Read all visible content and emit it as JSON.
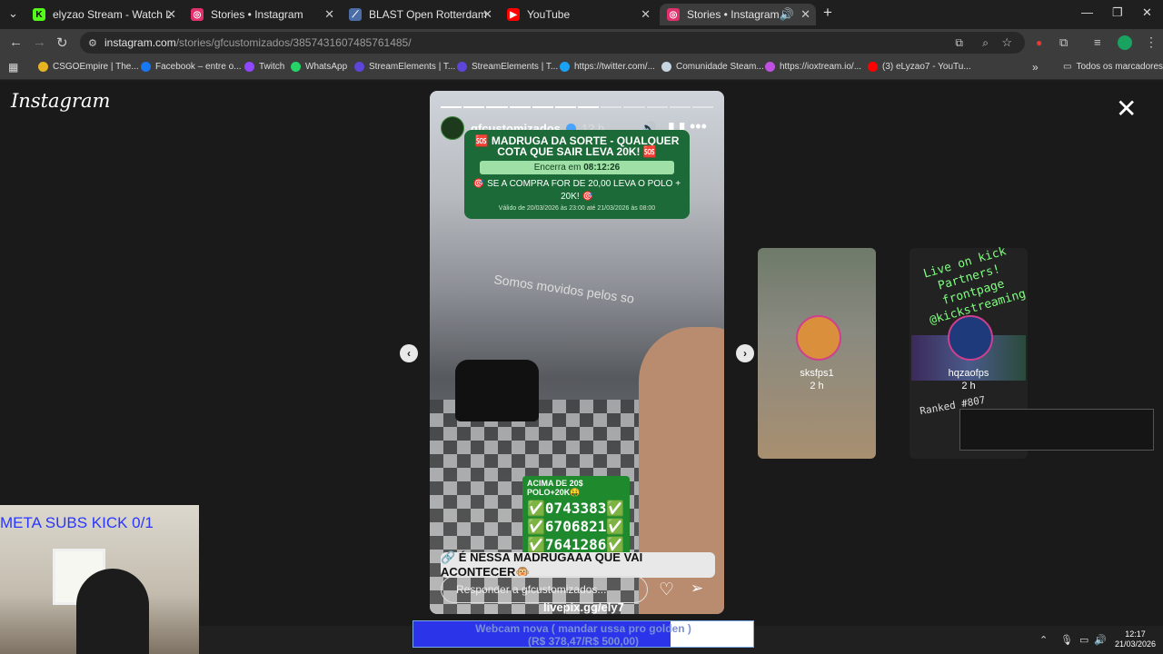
{
  "tabs": [
    {
      "title": "elyzao Stream - Watch Live on Kick",
      "icon": "kick-icon",
      "color": "#53fc18"
    },
    {
      "title": "Stories • Instagram",
      "icon": "instagram-icon",
      "color": "#e1306c"
    },
    {
      "title": "BLAST Open Rotterdam 2026 de",
      "icon": "hltv-icon",
      "color": "#4b6ea8"
    },
    {
      "title": "YouTube",
      "icon": "youtube-icon",
      "color": "#ff0000"
    },
    {
      "title": "Stories • Instagram",
      "icon": "instagram-icon",
      "color": "#e1306c"
    }
  ],
  "address": {
    "host": "instagram.com",
    "path": "/stories/gfcustomizados/3857431607485761485/"
  },
  "bookmarks": [
    {
      "label": "CSGOEmpire | The...",
      "color": "#e6b422"
    },
    {
      "label": "Facebook – entre o...",
      "color": "#1877f2"
    },
    {
      "label": "Twitch",
      "color": "#9146ff"
    },
    {
      "label": "WhatsApp",
      "color": "#25d366"
    },
    {
      "label": "StreamElements | T...",
      "color": "#5c45d8"
    },
    {
      "label": "StreamElements | T...",
      "color": "#5c45d8"
    },
    {
      "label": "https://twitter.com/...",
      "color": "#1da1f2"
    },
    {
      "label": "Comunidade Steam...",
      "color": "#c7d5e0"
    },
    {
      "label": "https://ioxtream.io/...",
      "color": "#c050e0"
    },
    {
      "label": "(3) eLyzao7 - YouTu...",
      "color": "#ff0000"
    }
  ],
  "bookmarks_folder": "Todos os marcadores",
  "instagram": {
    "logo": "Instagram"
  },
  "story": {
    "username": "gfcustomizados",
    "time": "12 h",
    "promo_title": "🆘 MADRUGA DA SORTE - QUALQUER COTA QUE SAIR LEVA 20K! 🆘",
    "countdown_label": "Encerra em",
    "countdown_value": "08:12:26",
    "promo_text": "🎯 SE A COMPRA FOR DE 20,00 LEVA O POLO + 20K! 🎯",
    "promo_validity": "Válido de 20/03/2026 às 23:00 até 21/03/2026 às 08:00",
    "wall_text": "Somos movidos pelos so",
    "numbers_header": "ACIMA DE 20$ POLO+20K🤑",
    "numbers": [
      "✅0743383✅",
      "✅6706821✅",
      "✅7641286✅"
    ],
    "caption": "🔗 É NESSA MADRUGAAA QUE VAI ACONTECER🐵",
    "reply_placeholder": "Responder a gfcustomizados...",
    "progress_total": 12,
    "progress_done": 7
  },
  "overlay": {
    "livepix": "livepix.gg/ely7",
    "meta": "META SUBS KICK 0/1"
  },
  "next_stories": [
    {
      "username": "sksfps1",
      "time": "2 h"
    },
    {
      "username": "hqzaofps",
      "time": "2 h"
    }
  ],
  "kick_promo": "Live on kick Partners! frontpage @kickstreaming",
  "ranked_text": "Ranked #807",
  "goal": {
    "label": "Webcam nova ( mandar ussa pro golden )",
    "value": "(R$ 378,47/R$ 500,00)",
    "progress": 0.7569
  },
  "clock": {
    "time": "12:17",
    "date": "21/03/2026"
  }
}
